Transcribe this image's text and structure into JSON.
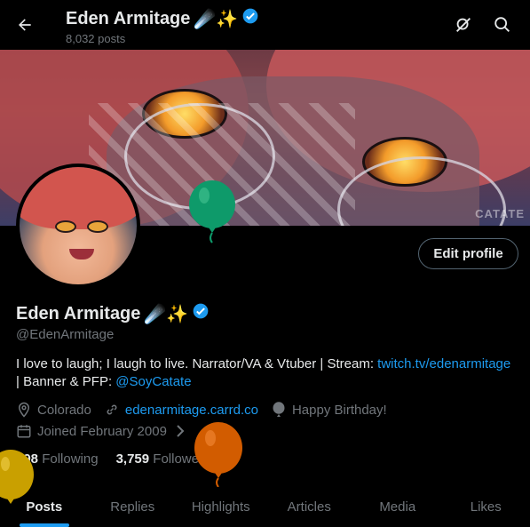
{
  "header": {
    "title": "Eden Armitage",
    "post_count": "8,032 posts",
    "icons": [
      "back-arrow-icon",
      "search-off-icon",
      "search-icon"
    ]
  },
  "banner": {
    "watermark": "CATATE"
  },
  "profile": {
    "edit_label": "Edit profile",
    "name": "Eden Armitage",
    "handle": "@EdenArmitage",
    "emoji": "☄️✨",
    "bio_text": "I love to laugh; I laugh to live. Narrator/VA & Vtuber | Stream:",
    "bio_link1": "twitch.tv/edenarmitage",
    "bio_mid": "| Banner & PFP:",
    "bio_link2": "@SoyCatate",
    "location": "Colorado",
    "website": "edenarmitage.carrd.co",
    "birthday": "Happy Birthday!",
    "joined": "Joined February 2009",
    "following_count": "998",
    "following_label": "Following",
    "followers_count": "3,759",
    "followers_label": "Followers"
  },
  "tabs": [
    {
      "label": "Posts",
      "active": true
    },
    {
      "label": "Replies"
    },
    {
      "label": "Highlights"
    },
    {
      "label": "Articles"
    },
    {
      "label": "Media"
    },
    {
      "label": "Likes"
    }
  ],
  "colors": {
    "accent": "#1d9bf0",
    "verified": "#1d9bf0",
    "balloon_green": "#0e9a6a",
    "balloon_orange": "#d25c00",
    "balloon_yellow": "#c9a000"
  }
}
